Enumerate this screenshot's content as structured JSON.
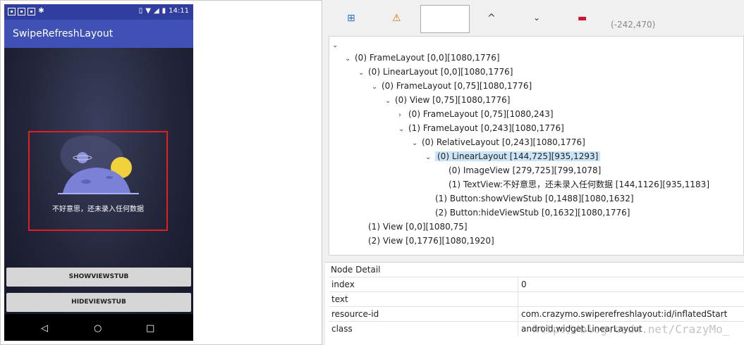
{
  "phone": {
    "status_time": "14:11",
    "app_title": "SwipeRefreshLayout",
    "empty_message": "不好意思，还未录入任何数据",
    "show_button": "SHOWVIEWSTUB",
    "hide_button": "HIDEVIEWSTUB"
  },
  "toolbar": {
    "coords": "(-242,470)"
  },
  "tree": [
    {
      "label": "(0) FrameLayout [0,0][1080,1776]",
      "twisty": "v"
    },
    {
      "label": "(0) LinearLayout [0,0][1080,1776]",
      "twisty": "v"
    },
    {
      "label": "(0) FrameLayout [0,75][1080,1776]",
      "twisty": "v"
    },
    {
      "label": "(0) View [0,75][1080,1776]",
      "twisty": "v"
    },
    {
      "label": "(0) FrameLayout [0,75][1080,243]",
      "twisty": ">"
    },
    {
      "label": "(1) FrameLayout [0,243][1080,1776]",
      "twisty": "v"
    },
    {
      "label": "(0) RelativeLayout [0,243][1080,1776]",
      "twisty": "v"
    },
    {
      "label": "(0) LinearLayout [144,725][935,1293]",
      "twisty": "v",
      "selected": true
    },
    {
      "label": "(0) ImageView [279,725][799,1078]",
      "twisty": ""
    },
    {
      "label": "(1) TextView:不好意思，还未录入任何数据 [144,1126][935,1183]",
      "twisty": ""
    },
    {
      "label": "(1) Button:showViewStub [0,1488][1080,1632]",
      "twisty": ""
    },
    {
      "label": "(2) Button:hideViewStub [0,1632][1080,1776]",
      "twisty": ""
    },
    {
      "label": "(1) View [0,0][1080,75]",
      "twisty": ""
    },
    {
      "label": "(2) View [0,1776][1080,1920]",
      "twisty": ""
    }
  ],
  "detail": {
    "title": "Node Detail",
    "rows": [
      {
        "key": "index",
        "value": "0"
      },
      {
        "key": "text",
        "value": ""
      },
      {
        "key": "resource-id",
        "value": "com.crazymo.swiperefreshlayout:id/inflatedStart"
      },
      {
        "key": "class",
        "value": "android.widget.LinearLayout"
      }
    ]
  },
  "watermark": "http://blog.csdn.net/CrazyMo_"
}
